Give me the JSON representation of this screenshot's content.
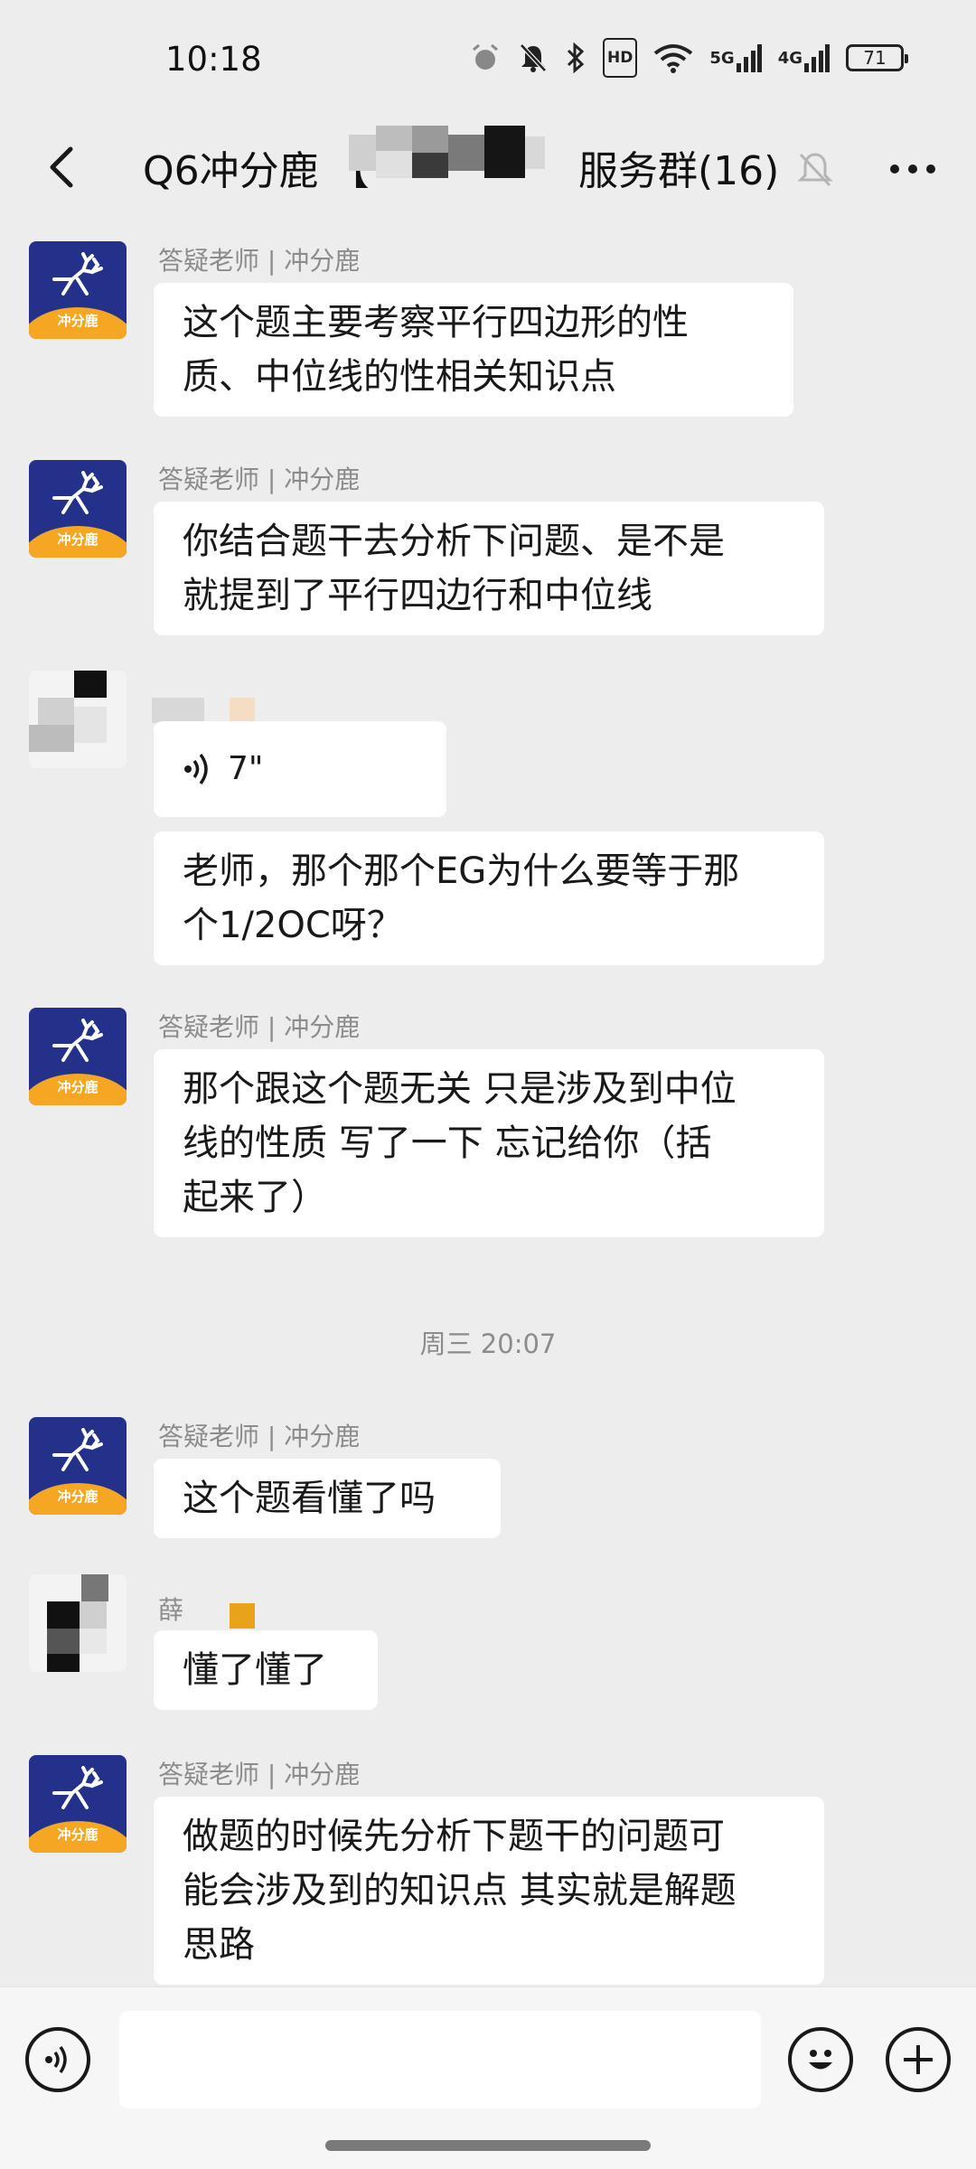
{
  "status_bar": {
    "time": "10:18",
    "hd": "HD",
    "net5g": "5G",
    "net4g": "4G",
    "battery": "71"
  },
  "header": {
    "title_prefix": "Q6冲分鹿",
    "title_bracket": "【",
    "title_suffix": "服务群(16)"
  },
  "messages": [
    {
      "sender": "答疑老师 | 冲分鹿",
      "lines": [
        "这个题主要考察平行四边形的性",
        "质、中位线的性相关知识点"
      ]
    },
    {
      "sender": "答疑老师 | 冲分鹿",
      "lines": [
        "你结合题干去分析下问题、是不是",
        "就提到了平行四边行和中位线"
      ]
    },
    {
      "voice_duration": "7\""
    },
    {
      "lines": [
        "老师，那个那个EG为什么要等于那",
        "个1/2OC呀？"
      ]
    },
    {
      "sender": "答疑老师 | 冲分鹿",
      "lines": [
        "那个跟这个题无关 只是涉及到中位",
        "线的性质 写了一下 忘记给你（括",
        "起来了）"
      ]
    },
    {
      "sender": "答疑老师 | 冲分鹿",
      "lines": [
        "这个题看懂了吗"
      ]
    },
    {
      "sender": "薛",
      "lines": [
        "懂了懂了"
      ]
    },
    {
      "sender": "答疑老师 | 冲分鹿",
      "lines": [
        "做题的时候先分析下题干的问题可",
        "能会涉及到的知识点 其实就是解题",
        "思路"
      ]
    }
  ],
  "timestamp": "周三 20:07",
  "brand_avatar_text": "冲分鹿",
  "colors": {
    "background": "#ededed",
    "bubble": "#ffffff",
    "brand_blue": "#23318a",
    "brand_orange": "#f5a623",
    "muted_text": "#8c8c8c"
  },
  "icons": [
    "back-arrow",
    "mute-bell",
    "more-dots",
    "voice",
    "emoji",
    "plus"
  ]
}
